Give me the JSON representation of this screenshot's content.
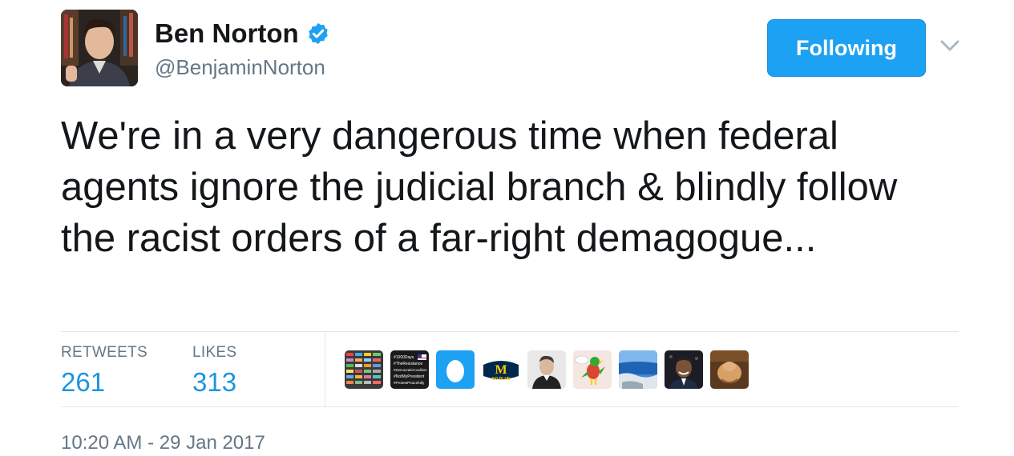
{
  "author": {
    "name": "Ben Norton",
    "handle": "@BenjaminNorton",
    "verified": true,
    "avatar_icon": "profile-photo"
  },
  "follow_button": {
    "label": "Following",
    "color": "#1da1f2"
  },
  "more_menu_icon": "chevron-down-icon",
  "tweet": {
    "text": "We're in a very dangerous time when federal agents ignore the judicial branch & blindly follow the racist orders of a far-right demagogue..."
  },
  "stats": {
    "retweets_label": "RETWEETS",
    "retweets_count": "261",
    "likes_label": "LIKES",
    "likes_count": "313"
  },
  "liked_by": [
    {
      "icon": "colorful-grid-avatar"
    },
    {
      "icon": "hashtag-list-avatar",
      "lines": [
        "#1000Days",
        "#TheResistance",
        "#DemocraticCoalition",
        "#NotMyPresident",
        "#ProtestPeacefully"
      ]
    },
    {
      "icon": "egg-avatar"
    },
    {
      "icon": "michigan-logo-avatar",
      "letter": "M",
      "text": "GO BLUE"
    },
    {
      "icon": "person-portrait-avatar"
    },
    {
      "icon": "cartoon-bird-avatar"
    },
    {
      "icon": "seascape-avatar"
    },
    {
      "icon": "smiling-man-avatar"
    },
    {
      "icon": "hands-avatar"
    }
  ],
  "timestamp": "10:20 AM - 29 Jan 2017",
  "colors": {
    "accent": "#1da1f2",
    "link": "#1b95e0",
    "muted": "#657786",
    "text": "#14171a"
  }
}
